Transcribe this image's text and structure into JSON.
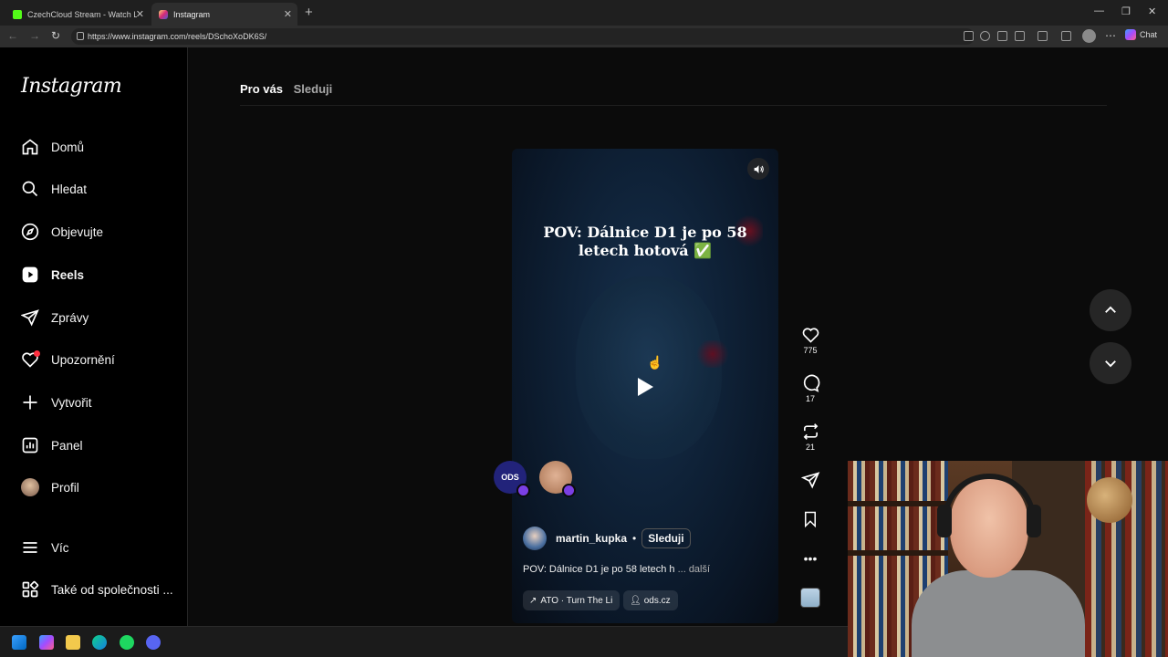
{
  "browser": {
    "tabs": [
      {
        "title": "CzechCloud Stream - Watch Live o",
        "active": false,
        "favicon_color": "#53fc18"
      },
      {
        "title": "Instagram",
        "active": true,
        "favicon_color": "#e1306c"
      }
    ],
    "url": "https://www.instagram.com/reels/DSchoXoDK6S/",
    "chat_label": "Chat"
  },
  "sidebar": {
    "logo": "Instagram",
    "items": [
      {
        "label": "Domů",
        "icon": "home-icon"
      },
      {
        "label": "Hledat",
        "icon": "search-icon"
      },
      {
        "label": "Objevujte",
        "icon": "compass-icon"
      },
      {
        "label": "Reels",
        "icon": "reels-icon",
        "active": true
      },
      {
        "label": "Zprávy",
        "icon": "send-icon"
      },
      {
        "label": "Upozornění",
        "icon": "heart-icon"
      },
      {
        "label": "Vytvořit",
        "icon": "plus-icon"
      },
      {
        "label": "Panel",
        "icon": "chart-icon"
      },
      {
        "label": "Profil",
        "icon": "avatar"
      },
      {
        "label": "Víc",
        "icon": "menu-icon"
      },
      {
        "label": "Také od společnosti ...",
        "icon": "apps-icon"
      }
    ]
  },
  "feed_tabs": {
    "for_you": "Pro vás",
    "following": "Sleduji"
  },
  "reel": {
    "overlay_title": "POV: Dálnice D1 je po 58 letech hotová ✅",
    "author": "martin_kupka",
    "follow_label": "Sleduji",
    "caption": "POV: Dálnice D1 je po 58 letech h",
    "caption_more": "... další",
    "music": "ATO · Turn The Li",
    "link": "ods.cz",
    "collab1_label": "ODS"
  },
  "actions": {
    "likes": "775",
    "comments": "17",
    "reposts": "21"
  },
  "accent": {
    "notification_dot": "#ff3040",
    "collab_badge": "#7b3fe4"
  }
}
